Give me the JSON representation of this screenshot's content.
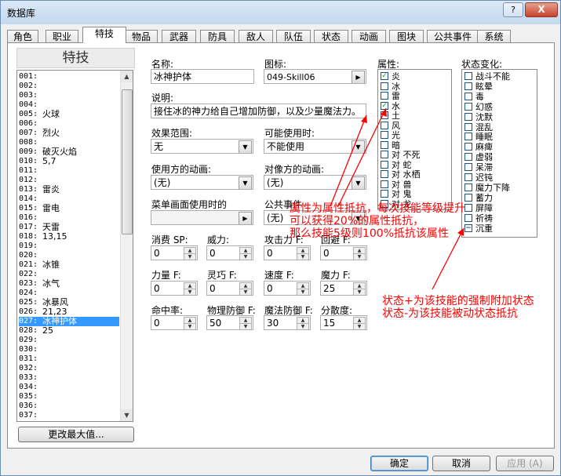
{
  "window": {
    "title": "数据库",
    "help": "?",
    "close": "X"
  },
  "tabs": [
    "角色",
    "职业",
    "特技",
    "物品",
    "武器",
    "防具",
    "敌人",
    "队伍",
    "状态",
    "动画",
    "图块",
    "公共事件",
    "系统"
  ],
  "skill_list": {
    "header": "特技",
    "items": [
      {
        "id": "001:",
        "name": ""
      },
      {
        "id": "002:",
        "name": ""
      },
      {
        "id": "003:",
        "name": ""
      },
      {
        "id": "004:",
        "name": ""
      },
      {
        "id": "005:",
        "name": "火球"
      },
      {
        "id": "006:",
        "name": ""
      },
      {
        "id": "007:",
        "name": "烈火"
      },
      {
        "id": "008:",
        "name": ""
      },
      {
        "id": "009:",
        "name": "破灭火焰"
      },
      {
        "id": "010:",
        "name": "5,7"
      },
      {
        "id": "011:",
        "name": ""
      },
      {
        "id": "012:",
        "name": ""
      },
      {
        "id": "013:",
        "name": "雷炎"
      },
      {
        "id": "014:",
        "name": ""
      },
      {
        "id": "015:",
        "name": "雷电"
      },
      {
        "id": "016:",
        "name": ""
      },
      {
        "id": "017:",
        "name": "天雷"
      },
      {
        "id": "018:",
        "name": "13,15"
      },
      {
        "id": "019:",
        "name": ""
      },
      {
        "id": "020:",
        "name": ""
      },
      {
        "id": "021:",
        "name": "冰锥"
      },
      {
        "id": "022:",
        "name": ""
      },
      {
        "id": "023:",
        "name": "冰气"
      },
      {
        "id": "024:",
        "name": ""
      },
      {
        "id": "025:",
        "name": "冰暴风"
      },
      {
        "id": "026:",
        "name": "21,23"
      },
      {
        "id": "027:",
        "name": "冰神护体"
      },
      {
        "id": "028:",
        "name": "25"
      },
      {
        "id": "029:",
        "name": ""
      },
      {
        "id": "030:",
        "name": ""
      },
      {
        "id": "031:",
        "name": ""
      },
      {
        "id": "032:",
        "name": ""
      },
      {
        "id": "033:",
        "name": ""
      },
      {
        "id": "034:",
        "name": ""
      },
      {
        "id": "035:",
        "name": ""
      },
      {
        "id": "036:",
        "name": ""
      },
      {
        "id": "037:",
        "name": ""
      }
    ],
    "selected_index": 26,
    "change_max_button": "更改最大值..."
  },
  "form": {
    "name_label": "名称:",
    "name_value": "冰神护体",
    "icon_label": "图标:",
    "icon_value": "049-Skill06",
    "desc_label": "说明:",
    "desc_value": "接住冰的神力给自己增加防御，以及少量魔法力。",
    "scope_label": "效果范围:",
    "scope_value": "无",
    "occasion_label": "可能使用时:",
    "occasion_value": "不能使用",
    "user_anim_label": "使用方的动画:",
    "user_anim_value": "(无)",
    "target_anim_label": "对像方的动画:",
    "target_anim_value": "(无)",
    "menu_se_label": "菜单画面使用时的",
    "common_event_label": "公共事件",
    "common_event_value": "(无)",
    "sp_cost_label": "消费 SP:",
    "sp_cost": "0",
    "power_label": "威力:",
    "power": "0",
    "atk_f_label": "攻击力 F:",
    "atk_f": "0",
    "eva_label": "回避 F:",
    "eva": "0",
    "str_f_label": "力量 F:",
    "str_f": "0",
    "dex_f_label": "灵巧 F:",
    "dex_f": "0",
    "agi_f_label": "速度 F:",
    "agi_f": "0",
    "int_f_label": "魔力 F:",
    "int_f": "25",
    "hit_label": "命中率:",
    "hit": "0",
    "pdef_f_label": "物理防御 F:",
    "pdef_f": "50",
    "mdef_f_label": "魔法防御 F:",
    "mdef_f": "30",
    "variance_label": "分散度:",
    "variance": "15"
  },
  "attributes": {
    "label": "属性:",
    "items": [
      {
        "name": "炎",
        "checked": true
      },
      {
        "name": "冰",
        "checked": false
      },
      {
        "name": "雷",
        "checked": false
      },
      {
        "name": "水",
        "checked": true
      },
      {
        "name": "土",
        "checked": false
      },
      {
        "name": "风",
        "checked": false
      },
      {
        "name": "光",
        "checked": false
      },
      {
        "name": "暗",
        "checked": false
      },
      {
        "name": "对 不死",
        "checked": false
      },
      {
        "name": "对 蛇",
        "checked": false
      },
      {
        "name": "对 水栖",
        "checked": false
      },
      {
        "name": "对 兽",
        "checked": false
      },
      {
        "name": "对 鬼",
        "checked": false
      },
      {
        "name": "对 龙",
        "checked": false
      }
    ]
  },
  "states": {
    "label": "状态变化:",
    "items": [
      {
        "name": "战斗不能",
        "mark": ""
      },
      {
        "name": "眩晕",
        "mark": ""
      },
      {
        "name": "毒",
        "mark": ""
      },
      {
        "name": "幻惑",
        "mark": ""
      },
      {
        "name": "沈默",
        "mark": ""
      },
      {
        "name": "混乱",
        "mark": ""
      },
      {
        "name": "睡眠",
        "mark": ""
      },
      {
        "name": "麻痺",
        "mark": ""
      },
      {
        "name": "虚弱",
        "mark": ""
      },
      {
        "name": "呆滞",
        "mark": ""
      },
      {
        "name": "迟钝",
        "mark": ""
      },
      {
        "name": "魔力下降",
        "mark": ""
      },
      {
        "name": "蓄力",
        "mark": ""
      },
      {
        "name": "屏障",
        "mark": ""
      },
      {
        "name": "祈祷",
        "mark": ""
      },
      {
        "name": "沉重",
        "mark": "−"
      }
    ]
  },
  "annotations": {
    "line1": "属性为属性抵抗，每次技能等级提升",
    "line2": "可以获得20%的属性抵抗，",
    "line3": "那么技能5级则100%抵抗该属性",
    "line4": "状态+为该技能的强制附加状态",
    "line5": "状态-为该技能被动状态抵抗",
    "color": "#ff0000"
  },
  "footer": {
    "ok": "确定",
    "cancel": "取消",
    "apply": "应用 (A)"
  }
}
